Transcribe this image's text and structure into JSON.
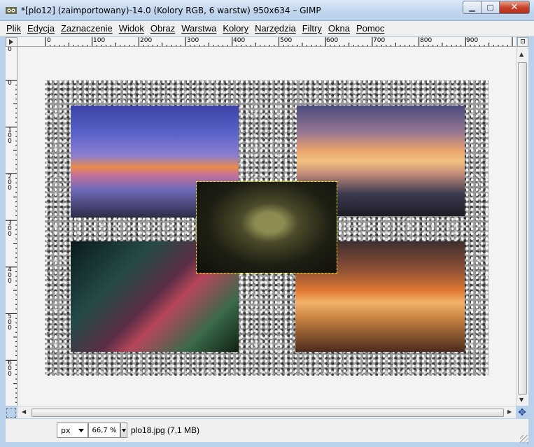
{
  "window": {
    "title": "*[plo12] (zaimportowany)-14.0 (Kolory RGB, 6 warstw) 950x634 – GIMP",
    "minimize_glyph": "▁",
    "maximize_glyph": "▢",
    "close_glyph": "✕"
  },
  "menu": {
    "items": [
      "Plik",
      "Edycja",
      "Zaznaczenie",
      "Widok",
      "Obraz",
      "Warstwa",
      "Kolory",
      "Narzędzia",
      "Filtry",
      "Okna",
      "Pomoc"
    ]
  },
  "rulers": {
    "horizontal_labels": [
      "0",
      "100",
      "200",
      "300",
      "400",
      "500",
      "600",
      "700",
      "800",
      "900"
    ],
    "vertical_labels": [
      "0",
      "0",
      "100",
      "200",
      "300",
      "400",
      "500",
      "600"
    ]
  },
  "status": {
    "unit": "px",
    "zoom": "66,7 %",
    "info": "plo18.jpg (7,1 MB)"
  },
  "icons": {
    "app": "gimp-wilber-icon",
    "navigate": "navigate-cross-icon",
    "quick_mask": "quick-mask-icon"
  },
  "colors": {
    "selection_outline": "#f0e400",
    "titlebar": "#c4d8ef",
    "close_button": "#c7432c"
  }
}
